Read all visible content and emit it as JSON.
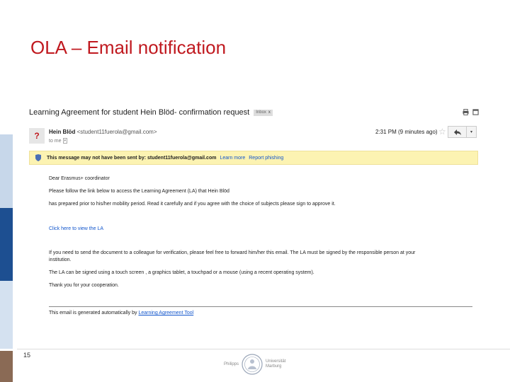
{
  "slide": {
    "title": "OLA – Email notification",
    "page_number": "15"
  },
  "email": {
    "subject": "Learning Agreement for student Hein Blöd- confirmation request",
    "label": "Inbox",
    "label_close": "x",
    "avatar_glyph": "?",
    "sender_name": "Hein Blöd",
    "sender_email": "<student11fuerola@gmail.com>",
    "to_line": "to me",
    "time": "2:31 PM (9 minutes ago)",
    "warning": {
      "message": "This message may not have been sent by: student11fuerola@gmail.com",
      "learn_more": "Learn more",
      "report_phishing": "Report phishing"
    },
    "body": {
      "greeting": "Dear Erasmus+ coordinator",
      "line1": "Please follow the link below to access the Learning Agreement (LA) that Hein Blöd",
      "line2": "has prepared prior to his/her mobility period. Read it carefully and if you agree with the choice of subjects please sign to approve it.",
      "view_link": "Click here to view the LA",
      "para1_line1": "If you need to send the document to a colleague for verification, please feel free to forward him/her this email. The LA must be signed by the responsible person at your",
      "para1_line2": "institution.",
      "para2": "The LA can be signed using a touch screen , a graphics tablet, a touchpad or a mouse (using a recent operating system).",
      "thanks": "Thank you for your cooperation.",
      "auto_prefix": "This email is generated automatically by",
      "auto_link": "Learning Agreement Tool"
    }
  },
  "logo": {
    "left_text": "Philipps",
    "right_text_1": "Universität",
    "right_text_2": "Marburg"
  },
  "colors": {
    "title": "#c0191f",
    "link": "#1155cc",
    "warning_bg": "#fcf3b2",
    "accent_dark": "#1d4f91",
    "accent_light": "#c7d7ea"
  }
}
